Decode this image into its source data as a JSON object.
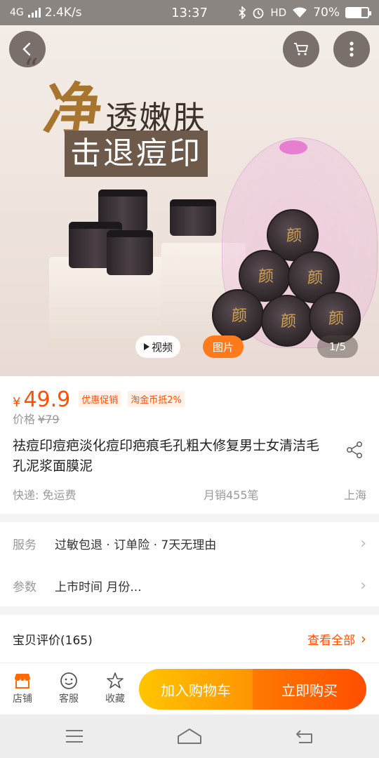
{
  "status_bar": {
    "network": "4G",
    "speed": "2.4K/s",
    "time": "13:37",
    "hd": "HD",
    "battery": "70%",
    "battery_level": 0.7
  },
  "hero": {
    "title_big": "净",
    "title_rest": "透嫩肤",
    "banner": "击退痘印",
    "video_label": "视频",
    "image_label": "图片",
    "page_indicator": "1/5",
    "icons": [
      "back-icon",
      "cart-icon",
      "more-icon",
      "play-icon"
    ]
  },
  "product": {
    "currency": "¥",
    "price": "49.9",
    "tag_promo": "优惠促销",
    "tag_coin": "淘金币抵2%",
    "orig_label": "价格",
    "orig_price": "¥79",
    "title": "祛痘印痘疤淡化痘印疤痕毛孔粗大修复男士女清洁毛孔泥浆面膜泥",
    "shipping": "快递: 免运费",
    "monthly_sales": "月销455笔",
    "location": "上海",
    "accent_color": "#ff5000"
  },
  "services": [
    {
      "key": "服务",
      "value": "过敏包退 · 订单险 · 7天无理由"
    },
    {
      "key": "参数",
      "value": "上市时间 月份..."
    }
  ],
  "reviews": {
    "title": "宝贝评价(165)",
    "see_all": "查看全部"
  },
  "action_bar": {
    "store": "店铺",
    "service": "客服",
    "favorite": "收藏",
    "add_to_cart": "加入购物车",
    "buy_now": "立即购买"
  }
}
